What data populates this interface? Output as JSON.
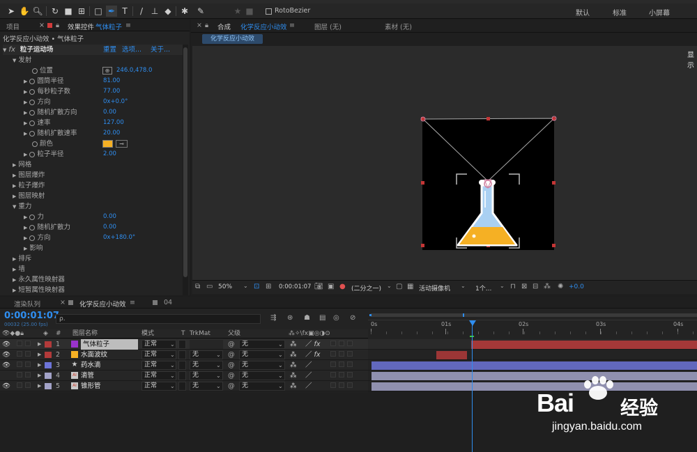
{
  "toolbar": {
    "rotobezier_label": "RotoBezier",
    "workspaces": [
      "默认",
      "标准",
      "小屏幕"
    ]
  },
  "effects_panel": {
    "tab_project": "项目",
    "tab_effects": "效果控件",
    "tab_effects_layer": "气体粒子",
    "breadcrumb": "化学反应小动效 • 气体粒子",
    "effect_name": "粒子运动场",
    "effect_links": [
      "重置",
      "选项...",
      "关于..."
    ],
    "rows": {
      "emit": "发射",
      "position": "位置",
      "position_val": "246.0,478.0",
      "barrel_radius": "圆筒半径",
      "barrel_radius_val": "81.00",
      "particles_per_sec": "每秒粒子数",
      "particles_per_sec_val": "77.00",
      "direction": "方向",
      "direction_val": "0x+0.0°",
      "random_spread_dir": "随机扩散方向",
      "random_spread_dir_val": "0.00",
      "velocity": "速率",
      "velocity_val": "127.00",
      "random_spread_vel": "随机扩散速率",
      "random_spread_vel_val": "20.00",
      "color": "颜色",
      "particle_radius": "粒子半径",
      "particle_radius_val": "2.00",
      "grid": "网格",
      "layer_exploder": "图层爆炸",
      "particle_exploder": "粒子爆炸",
      "layer_map": "图层映射",
      "gravity": "重力",
      "force": "力",
      "force_val": "0.00",
      "random_spread_force": "随机扩散力",
      "random_spread_force_val": "0.00",
      "gravity_direction": "方向",
      "gravity_direction_val": "0x+180.0°",
      "affects": "影响",
      "repel": "排斥",
      "wall": "墙",
      "persistent_mapper": "永久属性映射器",
      "ephemeral_mapper": "短暂属性映射器"
    },
    "particle_color": "#f5b024"
  },
  "comp_panel": {
    "tab_prefix": "合成",
    "tab_comp": "化学反应小动效",
    "tab_layer": "图层 (无)",
    "tab_footage": "素材 (无)",
    "comp_chip": "化学反应小动效",
    "right_edge_text": "显示",
    "zoom": "50%",
    "timecode": "0:00:01:07",
    "resolution": "(二分之一)",
    "camera": "活动摄像机",
    "views": "1个...",
    "exposure": "+0.0"
  },
  "timeline": {
    "tab_render": "渲染队列",
    "tab_comp": "化学反应小动效",
    "tab_other": "04",
    "current_time": "0:00:01:07",
    "frame_info": "00032 (25.00 fps)",
    "search_placeholder": "ρ.",
    "headers": {
      "num": "#",
      "layer_name": "图层名称",
      "mode": "模式",
      "t": "T",
      "trkmat": "TrkMat",
      "parent": "父级"
    },
    "ruler": [
      "0s",
      "01s",
      "02s",
      "03s",
      "04s"
    ],
    "layers": [
      {
        "num": "1",
        "name": "气体粒子",
        "mode": "正常",
        "trkmat": "",
        "parent": "无",
        "color": "#9933cc",
        "label_color": "#b23a3a"
      },
      {
        "num": "2",
        "name": "水面波纹",
        "mode": "正常",
        "trkmat": "无",
        "parent": "无",
        "color": "#f5b024",
        "label_color": "#b23a3a"
      },
      {
        "num": "3",
        "name": "药水滴",
        "mode": "正常",
        "trkmat": "无",
        "parent": "无",
        "color": "#6d74d8",
        "label_color": "#6d74d8"
      },
      {
        "num": "4",
        "name": "滴管",
        "mode": "正常",
        "trkmat": "无",
        "parent": "无",
        "color": "#a3a3c8",
        "label_color": "#a3a3c8"
      },
      {
        "num": "5",
        "name": "锥形管",
        "mode": "正常",
        "trkmat": "无",
        "parent": "无",
        "color": "#a3a3c8",
        "label_color": "#a3a3c8"
      }
    ]
  },
  "watermark": {
    "brand": "Bai",
    "brand_suffix": "经验",
    "url": "jingyan.baidu.com"
  }
}
